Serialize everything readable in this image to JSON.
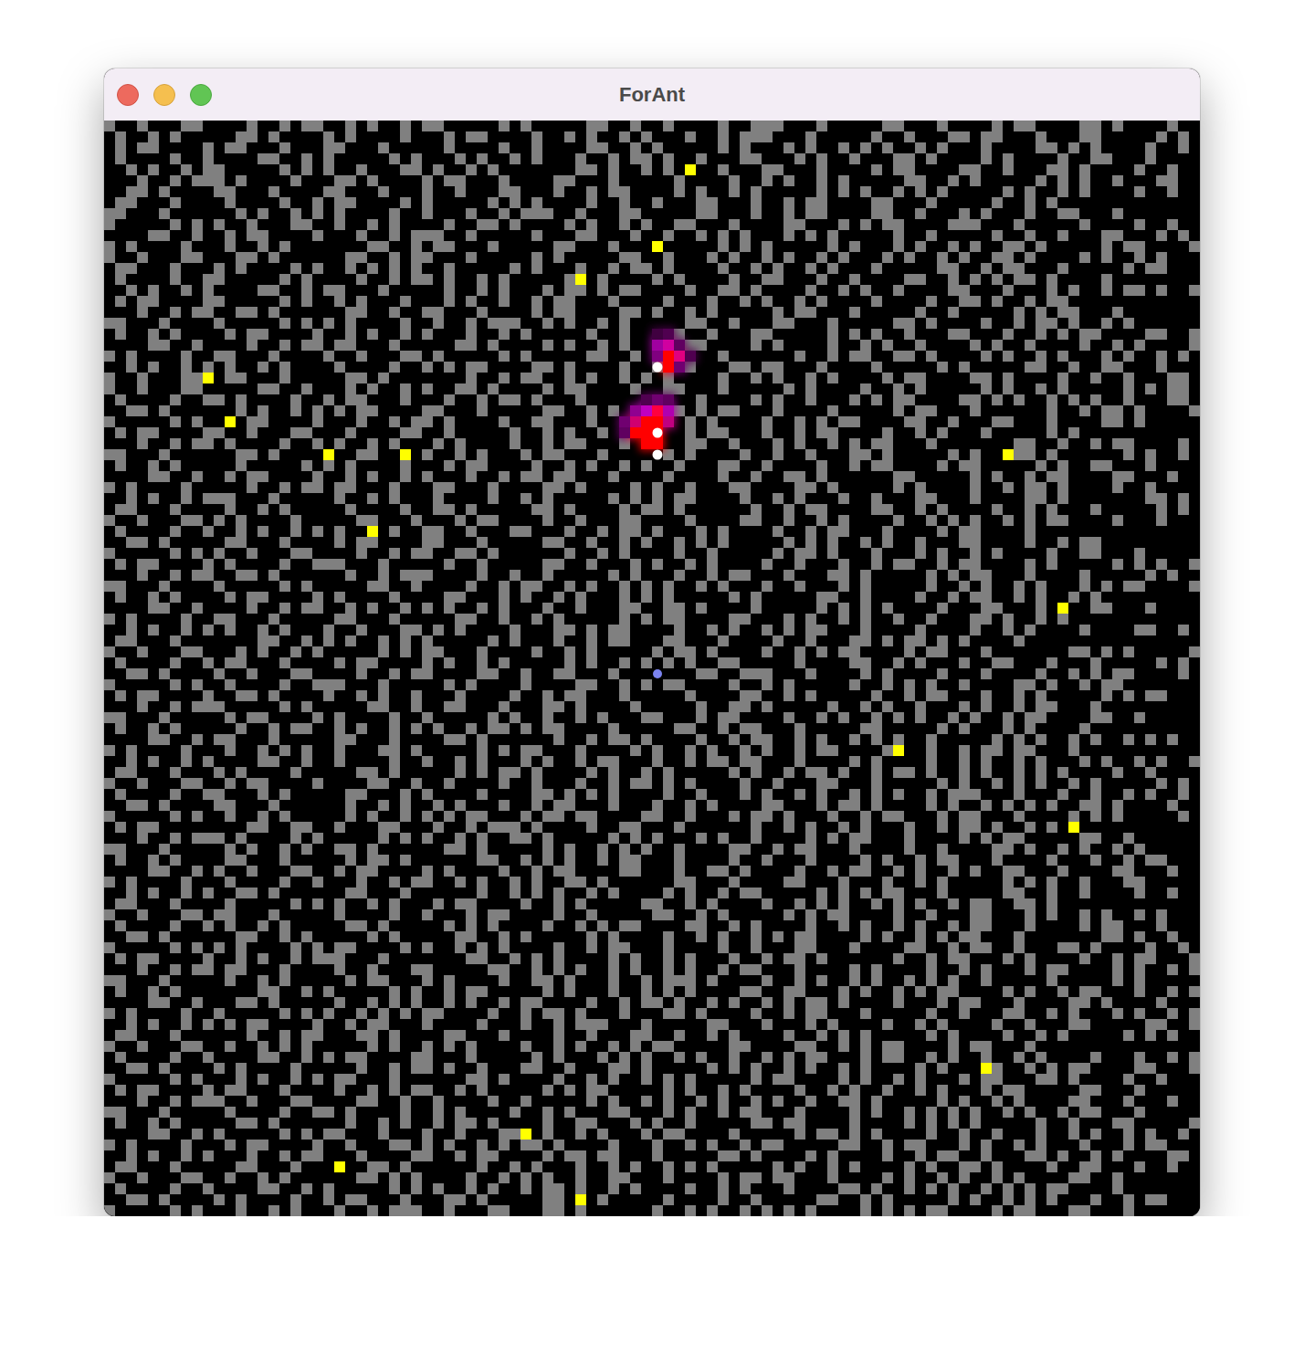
{
  "window": {
    "title": "ForAnt"
  },
  "grid": {
    "rows": [
      "#..#...##....#..#.##..#.#..#.##.....#.#.....##..#..#....#..###...#.....##...#....#.##....##.#....#..",
      ".#..#.#.....##.#....#.#....#...#.##....#..#.#..#.#...#..#.###...#.....#..#...##.##...#...##.....#.#.",
      ".#.##....#.##...#...##...#.....#....#..#....##..#.#.....#.#...#.#..#.#.#..#.#...#....##.#.#....#..#.##",
      ".#....#..#....##..#.#.....#.#...#.#..#.#...#..#.##.#..#...##...#.#..#...##.#....#.#....#..##...#....",
      "..#.#..#.##.....#.#.#..#...##.#..#.#.......##.#..#.#.F..#...##...#....#.##....##..#...##.#....#..#....##..#.",
      "...#..#.###.#....#...##.#....#.##...#....##...#.....#....#..#.#..#.#.....##..#.#.....#.#.#..#...##.",
      "..##.#....##...#....##...#...#..#...##...#..#.##....#.#..#.#.....#.#.#..#.#.#.....#.#..#.#....#..#",
      ".##...#....#....#..#.##....#.#.....#.#.#....#..#..#...##...#..#.##....##...#.....#..#.#...",
      "##...#......#.#..#.#.#....#..#...#..#.###..#...##.....##...#..#.##....##..#...#.#...#..##...#...",
      "#.....#.#.#..#...##..#..#.#....#..##.#....#.#..#.#..##...#....##...#.#.##....###...#.....#....#..#...#.##",
      "....##..#..#.##....#...#..#.###..#.....#...##...#..#..#.#.#...#.#.#.....#..#.....#..#..#...##...#.#..#.#",
      "#.#....#...#..#.#.......##..#.##...#.....##...#...F.....#.#.#.....#.#...#.#..#.#..##.#.....#.##....#",
      "#..#...##...##.#......##..#.##...#.....#.#.....##..#...#.#..#.#..#.#...#.#..#.#..##.#....#.#..#.#...",
      ".##...#...#.#....#.#..#.#.#.#..#.....#.#...#..#.##.#....#..#.#..#.#...#.....##..#.##...#.....#.##....#",
      ".#....#..##.....#.#....#..#.##.#..#.#.....#F.#....#.#....#..##...#..#....##..#.#.#.##.#....#..",
      "..#.#..#.#....##..#.##...#.....#..#.#...#.##.#.##....#..##.#....#..#.#..#....##...#...#.#..#.##.#..#.#...",
      ".#.##....##.....#.#..#.#...#...#.#..#..#.##...#....#...#..#.#..#.#....#....#..##.#..#.##",
      "...#..#.##..##.#......##..#..##...#....#.##....##.#..#.#.....#.##...#.....#..#.....#.#.##...#....",
      "##...#....#.....#.#.#.#....#..#..#.###..#.#..#.#.....##..#...##...#.....##.#....#..#.##.#..#.#...",
      ".#..#.#....#.##....#..#.#..#.#...#..#.#.....#..#..#.#..#...##.....#.#.#..#...##...#..#.#.##....##..#.",
      "....##..#....#..#.##.##...#.....##.#....#.#..#.#...#.##....#.#....#..#.#..#....#.#..#....#..#.#....#..",
      "#.#....#..##...#....#..#...##.#.....#.#.....##..#..##...#......#..#.##..##.#....#.#..#.#...#.#..#.#",
      "..#.#..#.#.#..#.#....#....#..#.#.##....##.#....#..#..#...##.##...#....#.....#.#.....##..#..##...#...",
      "#..#...##F.##...#.....##.#.......#..#.##..#.#..#.#.#....#..#.#..#.#....#.##....##.#....#..#..#...##.",
      "#..#...##.....##..#...#.#..#.#..##.#....#.##....#..##...#.....#.#....#..#.#.....#.#..#.#.....#.#.##...#...",
      ".#....#..##.#....#..#.##...#...#..#.##.#...#.....##...#....#.#..#...#.#.##....##.#.#..#.#.#..#...##.",
      "..##.#......#.#..#.#.#.##....##...#.....##..#.#.....#.#.##...#....#.....#.##...#......#..#.##.#....#..#",
      "#.....#.#..F.##....#...#..#.##.#....#..##...#..#.#...#.#....#..#.#.##....##..#...##...#....##.#....",
      ".#.##....##..#...##...#....##..#.....#..#.#..#.#..#..#.##...#..#.##....#..#.#...#.....#.#.",
      "...#..#.##.#....#..#.#..#.#...#.#....#..#.##...#.....##..#...#.#..#.#.##...#.......##..#..#.##....#",
      "##...#......##.#....F..##..F.#..#.#...#.##...#.....#.#....#..#..#...##.#.....#.#..F##.#......#.#..#.#",
      ".#..#.#.....#.....#.#.#....#...#.##....#..#.#..#.#..#...##..#....#..#.##....#.##.....#.#..##...#...",
      "....##..#..#.##....#..#.#..#.#...#..#.##.##...#....#....#..#..##.#......##.....#.#..#.##....##...#..#.",
      "#.#....#.....#..#.##.##...#...##...#....##.#....#.#..#...##....##.#.....#.#....#..#.##.#....#..#",
      "..#.#..#.###...#.....#..#.#...#....#..#.#.....#.#.#.##....#..#.#...#..#...##...#....##.#.......##.#....",
      ".##...#....#..#.#.....#....#..##.#.....##.#....#.##.#......#..#.##....##..#.#....#..#.#...#.....#.#.",
      "#..#...##.#.#....#.....##...#...#.##....#..#...##....#....##..#..#.#....#..#.#.#..#.#.##....#...#...",
      ".#....#..#..#.#..#.#.#..F.#..##..#...##...#..#.##.#...#.#....#..#.##...#....#.##....#",
      "..##.#.....##...#....#.##....##...#.....##..#..#.#..#.#.#.....#.#.#..#.#..#...##....#..#.##",
      "#.....#.#.#..#...##....#..#.##..##.#......#..#.#....#..#.....#.##.#...#...#.#..#.#....#..##...#....",
      ".#.##....#.#....#..###...#.....#..#.....##..#...#.#..#.#....#..#...#..#.##..#.##....#.#.....#.#.#..#.#...",
      "...#..#.##..##.#......#..#.###....#..#..#.....#.#...#..#.##...#...##.#.....#.#.##...#....#.....#.#.....##..#.",
      "##...#....#.....#.#.....##..#....#..#.##..#.#..#.#.#..#.#...#..#...#.#.....#..#.#..#.#...#.#.##....##....",
      ".#..#.#....#.##....#.#....#....##...#.#..#.#...#.#.#.....#.#.....##..#....#..#.##..#.#..#.#",
      "....##..#....#..#.##..#.#..#.#.#..#.#...#..#...##..##.#....#.....#.#.#.#....#...##...#.F..##...#...",
      "#.#....#..##...#.....##...#.....##..#..#.#.....#.#.##....##...#.#..#.#..#..#...##.#..#.#...",
      "..#.#..#.#.#..#.#...#..#...##.#.#....#...##.#.##....#..#.#..#.#.##...#....#....#..#.#....#....##..#.",
      ".##...#.......##..#.#.#..#.#.#.....#.#...#..#.##...##...#....#..#...##.#.##.#.#....#..",
      "#..#...##...#.#..#.#.....#.#.##...#....#..#.#.....#.##.#....#..#.#.##....#.##...#.......##.#.#.....#.#.",
      ".#....#..#.##...#....#.##....#.#..#.#.....#.#..#.#.#.#..##.....#....##..#.#...#..##...#...#.....#.#.",
      "..##.#....#..#...##....#..#.##....##..#..##...#...N...##..###...#....#.#....#...#....#..#.#.##....#",
      "#.....#.#..#....#..###...#.....#.#....#....##..#.#.##....#..#.#.....#..#.#.#..#....##.#..#.##",
      ".#.##....#..##.#....#..#.#..#...#....#..#.##...#.....#....##..#.#.....#..#.##...#..#.#.....#.#.##...#....",
      "...#..#.###.....#.#.....##..#..##...#...##.#....#.....#..##.#.....#..#.#..#...#.#..#.##...#.",
      "##...#.....#.##....#.#....#..#.....#.#..#..#.#...##...#.##....#..#.#..#.#.#..#.#..#.##....##..#.",
      ".#..#.#.....#..#.##..#.#..#.#.#..#.##.#.##....#.....##..#.##...#.....##.....#.#...#.#....#..",
      "....##..#.##...#.....##...#....##.#......#..#.##.#....#..#.##..#.#..#.#.#..#.....#.#.#..#.#..#.#.#..#.#",
      "#.#....#...#..#.#.#..#...##.#.....#.#.##...#....#.#..#.#..#.#..#.##....#F..#..#.##.##...#...",
      "..#.#..#.#....##..#..#....#..#..#.#...#.#..#.##...#..#.##.##...#....#.#....#..#.#..#.#...#.#..#.#..#.#",
      ".##...#...#.#....#.....##.#.....#.#.##.#....#.#..#.#.....#.#..#.##.#..#.##.#..#.#..#.#.#....#..#",
      "#..#...##..#.##....#....##..#..#....#..#...#..#.##.#.#....#..#...##...#.....#.#..#.#.#..#.#.....#.#.",
      ".#....#..##...#.#.....##...#.#....#....##.#.#.#....#..#...#.#..#.#..#.#.#..#.###...#...#..#..#.#..#.##.",
      "..##.#....##...#......#..#.#..#.#...#..#.##...#...#..#.#....##...#.##.#....#.#..#.#.#.#..##.#....#..",
      "#.....#.#..#..#.#.....#.#..#.#.#.##...#.##.##....##..#...#.##.#...#..#.##...#.##...#....#.#.#.....#.#.#...",
      ".#.##........##..##..#...##...#..#.###.#....#..##...#......#..#.#..#.#...#..#.##.#..#.#.F",
      "...#..#.###.#....#.#.....#.#.#..#.#..##.#.....#.#.#...#.#..#....#.#.##...#....#.#.##.....##..#.",
      "##...#.....#.#..#.#..##.#......##.#.....#.#..#.#.#..#....##..#.##...#....#..#....##.#..#.#..#.#",
      ".#..#.#....##...#.....#.##.#......##..#.#.#..#.##...#....#..#...#....#.#..#.##...#....#...#..#.##",
      "....##..#.#..#...##..#.##....#.#....#..#.##....##...#..##.#....#..#.##..#.#..#.#..##...#....##...#...",
      "#.#....#...#....#..#...#..#.##..#.#..#.#..##.#......##...#....##...#...#..#.#.....#.#.#..#...##.",
      "..#.#..#.#..##.#......##...#......#..#.#.#..#.#....#.#..#.##.....#.#.#.##...#.....##..#..#....#..#",
      ".##...#....#.....#.#.#..#.#...#.##....#..#.#.....##..#.#....#..#.#.#..#.#.#..#.##..##.#....",
      "#..#...##.##...#.....#....#..#...#.##....#..#.....##..#.#.....#.#.##....#..#...##...#.#..#.#..#.#.",
      ".#....#..#.#..#.#.....##.#.....#.#.#....#..#.#.##....##..#.#....#..#.#..#.#..#.##...#....#.##...#...",
      "..##.#......##..#.#.....#.#.....##..#.#.....#.#....#..#.#..#.#.##....#.#..#.#.##...#.......##.#..#...##.",
      "#.....#.#.#.#....#.#.##....#.#..#.#.#....#..#.##...#....#..#...##...#....##..#.##..#...##.#....#..#",
      ".#.##....#..#.#..#.###...#.......##..#.#.#....#.#..#.#...#..#.##.#......#..#.##...#.#....#..#.##...#....",
      "...#..#.##.##...#....#..#...##.....##..#.#.#..#.#..#.#..#.##...#....#.#....#..#.#...#.##....#.#..#.#...",
      "##...#.....#..#.#.....#.##...#.#....#..##.#...#..#.###.#....#..#.#..#.#..#.#.#..#.....#.....#.#.",
      ".#..#.#.......##..#.#.....#.#..#.##.....#.#...#..#.#.#....##..##...#.#..#.#.##....#.#..#.##...#..#.##",
      "....##..#...##.#.....#..#.#.#..#.#..#.##....#..#.##.#..#.#..#.#.##.#....#...#.##...#....##.#....#..",
      "#.#....#..#.....#.#.#..#.#.#.##....#..#.##.#...#...##.#....#..#.##...#.....#..#...##..#.#...#.#..#.#",
      "..#.#..#.#.#.##....#..#.##...#....#...#..#.###...#.....##...#...#.#....#..#.#....#..#...##.....##..#.",
      ".##...#......#..#.##...##.#....##...#....#..#...##..#..#.#....#..#.#.#.....#.#....#..#.#.....#.#.#..#.#",
      "#..#...##..#..#.#.#.....#.#..#.#.#....#..#.#..#.#.##.....##....##..#.#.##....#.##...#....",
      ".#....#..#....##..#.#.##....##...#.....#.#...#.#.#..#.#..#..#.#.##...#.##..#.#..#..#.#....#...#..#.##",
      "..##.#....#.#....#.....#..#.##.#..#...##..#...##.#.....#.#.#..#.#..#.#....#.#...F#..#.#.##....##...#...",
      "#.....#.#...#.#..#.#.##...#......##.#....#..#.#..#.#.#.....#.##....#.#..#.#...#.##...##.#....#..#....#.##",
      ".#.##....#.##...#....#..#.#.##..#.#.....#.#.##.....#.#..#.#....#..#.#..#..#.#...#.##.....##...#....",
      "...#..#.###..#...##....##..#..#....#..#.....#.#..#.#..#.#..#.#..#..##.#.....#.#..#.#....##...#...#..#.",
      "##...#.....#....#..##.#....#..#.#....#..#.#...##...#.#..#.##...#....#.#..#.#.#.#..#.#..#.##...#.",
      ".#..#.#.....##.#......#..#.#..#.##.#....#..##...#.#..#.....##.##....#....#.#.#.#.....#..#...##.....#.#.",
      "....##..#.#.....#.#.##...#...#..#...##F.#..#.#...#.##....#.....#.##.#.#....#..#..#...#..#.#..#.#..#.##",
      "#.#....#...#.##....#..#...##.#.#..#.#.##.#....#...#..#.#..#.##.....##..#.##...#.#..#.#...#...#.##...#...",
      "..#.#..#.#...#..#.##...#....##..#.##....#.##.##...#.....##.#....#.#....#..#.##..#...##.#..#.#....##..#.",
      ".##...#.....##...#...F..##.#......#..#.#...#..#.#..#.#.#.....#.#..#.#....#.#..##.#....#..##...#..#.",
      "#..#...##..#..#.#......##.#.#....#..#.#.#..#..##...#....#.##.##...#....#.#..#.#..#.#....##..#.",
      ".#....#..#....##..#.#.....#.#.#..#.#..#.##.#..#.#....#..#.#...#....##.#..#.#.#..#.#.#.##....#",
      "..##.#....#.#....#..#.##...#...##.#.....##.F.#.....#....#..#.....##..#.#.....#.#..#.#.#...#..#.##",
      "#.....#.#...#..#.#...#..#.###..#...##...##.#......#..#.#..#.#.#.#....#.#.#.##....#.##...##...#...."
    ]
  },
  "pheromones": [
    {
      "row": 19,
      "col": 50,
      "color": "#400040"
    },
    {
      "row": 19,
      "col": 51,
      "color": "#500050"
    },
    {
      "row": 20,
      "col": 50,
      "color": "#a000a0"
    },
    {
      "row": 20,
      "col": 51,
      "color": "#d000a0"
    },
    {
      "row": 20,
      "col": 52,
      "color": "#600060"
    },
    {
      "row": 21,
      "col": 50,
      "color": "#800080"
    },
    {
      "row": 21,
      "col": 51,
      "color": "#ff0000"
    },
    {
      "row": 21,
      "col": 52,
      "color": "#e00080"
    },
    {
      "row": 21,
      "col": 53,
      "color": "#500050"
    },
    {
      "row": 22,
      "col": 51,
      "color": "#ff0000"
    },
    {
      "row": 22,
      "col": 52,
      "color": "#700070"
    },
    {
      "row": 25,
      "col": 49,
      "color": "#500050"
    },
    {
      "row": 25,
      "col": 50,
      "color": "#700070"
    },
    {
      "row": 25,
      "col": 51,
      "color": "#600060"
    },
    {
      "row": 26,
      "col": 48,
      "color": "#900090"
    },
    {
      "row": 26,
      "col": 49,
      "color": "#c000c0"
    },
    {
      "row": 26,
      "col": 50,
      "color": "#ff0040"
    },
    {
      "row": 26,
      "col": 51,
      "color": "#b000b0"
    },
    {
      "row": 27,
      "col": 47,
      "color": "#700070"
    },
    {
      "row": 27,
      "col": 48,
      "color": "#d00070"
    },
    {
      "row": 27,
      "col": 49,
      "color": "#ff0000"
    },
    {
      "row": 27,
      "col": 50,
      "color": "#ff0000"
    },
    {
      "row": 27,
      "col": 51,
      "color": "#c00080"
    },
    {
      "row": 28,
      "col": 47,
      "color": "#600060"
    },
    {
      "row": 28,
      "col": 48,
      "color": "#ff0000"
    },
    {
      "row": 28,
      "col": 49,
      "color": "#ff0000"
    },
    {
      "row": 28,
      "col": 50,
      "color": "#ff0000"
    },
    {
      "row": 29,
      "col": 49,
      "color": "#ff0000"
    },
    {
      "row": 29,
      "col": 50,
      "color": "#ff0000"
    }
  ],
  "ants": [
    {
      "row": 22,
      "col": 50
    },
    {
      "row": 28,
      "col": 50
    },
    {
      "row": 30,
      "col": 50
    }
  ]
}
